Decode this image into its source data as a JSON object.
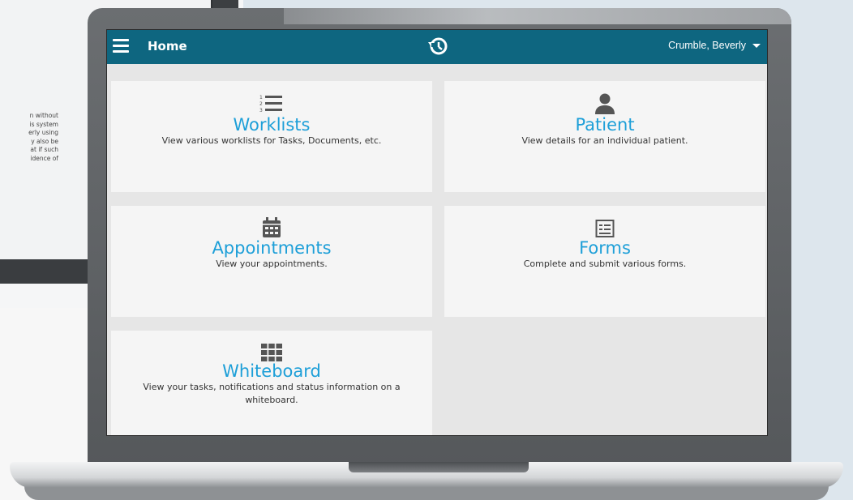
{
  "background_text": [
    "n without",
    "is system",
    "erly using",
    "y also be",
    "at if such",
    "idence of"
  ],
  "topbar": {
    "title": "Home",
    "user_name": "Crumble, Beverly",
    "menu_icon": "hamburger-menu-icon",
    "history_icon": "history-icon"
  },
  "tiles": [
    {
      "title": "Worklists",
      "description": "View various worklists for Tasks, Documents, etc.",
      "icon": "numbered-list-icon"
    },
    {
      "title": "Patient",
      "description": "View details for an individual patient.",
      "icon": "person-icon"
    },
    {
      "title": "Appointments",
      "description": "View your appointments.",
      "icon": "calendar-icon"
    },
    {
      "title": "Forms",
      "description": "Complete and submit various forms.",
      "icon": "form-icon"
    },
    {
      "title": "Whiteboard",
      "description": "View your tasks, notifications and status information on a whiteboard.",
      "icon": "grid-icon"
    }
  ],
  "colors": {
    "topbar": "#0e6680",
    "tile_title": "#1d9fd8",
    "tile_bg": "#f5f5f5",
    "screen_bg": "#e6e6e6"
  }
}
